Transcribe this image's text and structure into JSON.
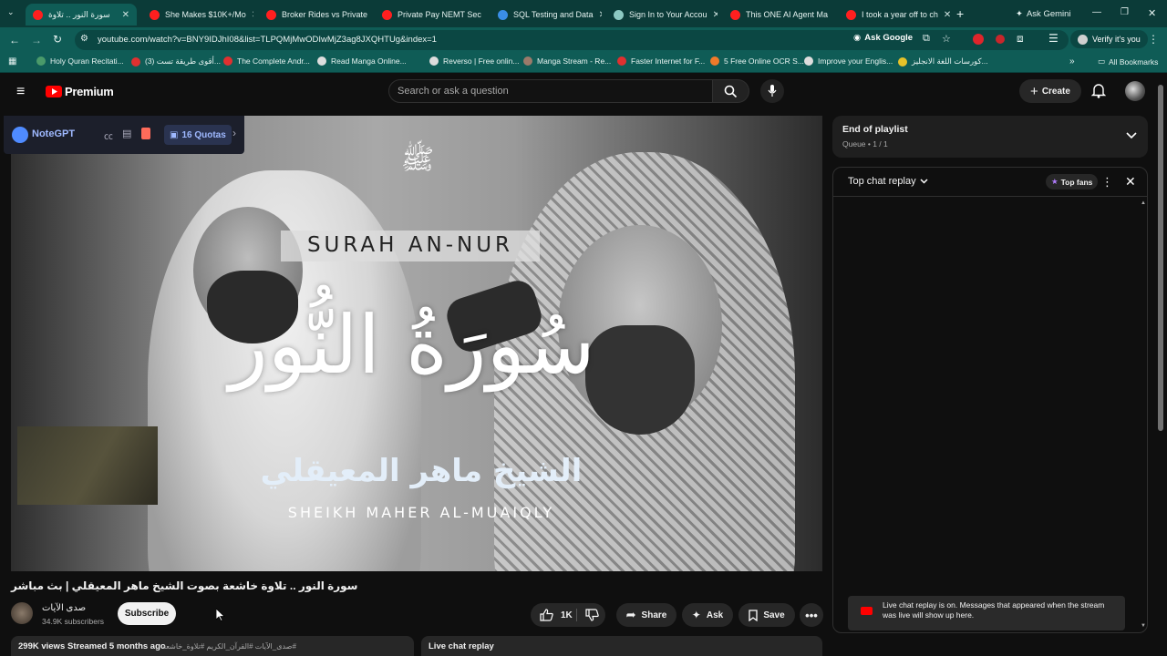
{
  "browser": {
    "tabs": [
      {
        "title": "سورة النور .. تلاوة",
        "active": true
      },
      {
        "title": "She Makes $10K+/Mo"
      },
      {
        "title": "Broker Rides vs Private"
      },
      {
        "title": "Private Pay NEMT Sec"
      },
      {
        "title": "SQL Testing and Data"
      },
      {
        "title": "Sign In to Your Accou"
      },
      {
        "title": "This ONE AI Agent Ma"
      },
      {
        "title": "I took a year off to ch"
      }
    ],
    "ask_gemini": "Ask Gemini",
    "url": "youtube.com/watch?v=BNY9IDJhI08&list=TLPQMjMwODIwMjZ3ag8JXQHTUg&index=1",
    "ask_google": "Ask Google",
    "verify": "Verify it's you",
    "bookmarks": [
      "Holy Quran Recitati...",
      "(3) أقوى طريقة تست...",
      "The Complete Andr...",
      "Read Manga Online...",
      "Reverso | Free onlin...",
      "Manga Stream - Re...",
      "Faster Internet for F...",
      "5 Free Online OCR S...",
      "Improve your Englis...",
      "كورسات اللغة الانجليز..."
    ],
    "all_bookmarks": "All Bookmarks"
  },
  "youtube": {
    "logo": "Premium",
    "search_placeholder": "Search or ask a question",
    "create": "Create",
    "notegpt": {
      "label": "NoteGPT",
      "quotas": "16 Quotas"
    },
    "video": {
      "surah_en": "SURAH AN-NUR",
      "surah_ar": "سُورَةُ النُّور",
      "sheikh_ar": "الشيخ ماهر المعيقلي",
      "sheikh_en": "SHEIKH MAHER AL-MUAIQLY",
      "title": "سورة النور .. تلاوة خاشعة بصوت الشيخ ماهر المعيقلي | بث مباشر"
    },
    "channel": {
      "name": "صدى الآيات",
      "subscribers": "34.9K subscribers",
      "subscribe": "Subscribe"
    },
    "actions": {
      "likes": "1K",
      "share": "Share",
      "ask": "Ask",
      "save": "Save"
    },
    "meta": {
      "views": "299K views",
      "streamed": "Streamed 5 months ago",
      "tags": "#صدى_الآيات #القرآن_الكريم #تلاوة_خاشعة"
    },
    "live_chat_tab": "Live chat replay",
    "playlist": {
      "title": "End of playlist",
      "queue": "Queue • 1 / 1"
    },
    "chat": {
      "title": "Top chat replay",
      "top_fans": "Top fans",
      "notice": "Live chat replay is on. Messages that appeared when the stream was live will show up here."
    }
  },
  "colors": {
    "chrome": "#0f5c56",
    "chrome_dark": "#0b3b38",
    "yt_red": "#ff0000",
    "notegpt_blue": "#4f8bff"
  }
}
